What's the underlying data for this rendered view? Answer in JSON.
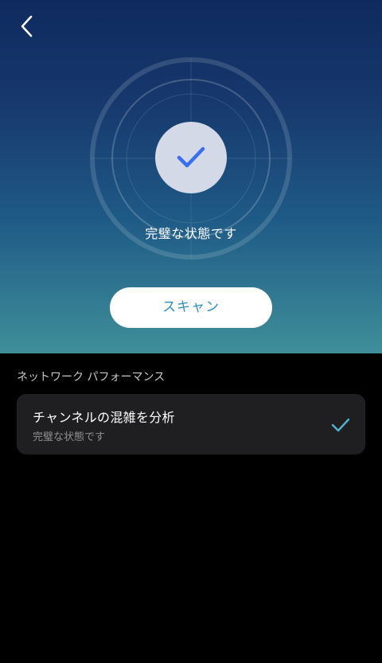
{
  "header": {
    "back_icon": "chevron-left-icon"
  },
  "hero": {
    "status_icon": "checkmark-icon",
    "status_text": "完璧な状態です",
    "scan_button_label": "スキャン",
    "colors": {
      "gradient_top": "#0f2a5e",
      "gradient_bottom": "#3f8f9a",
      "check_color": "#3a6ef0",
      "scan_text_color": "#2f8fbf"
    }
  },
  "section": {
    "title": "ネットワーク パフォーマンス",
    "items": [
      {
        "title": "チャンネルの混雑を分析",
        "subtitle": "完璧な状態です",
        "status_icon": "checkmark-icon",
        "status_color": "#4fb3d0"
      }
    ]
  }
}
